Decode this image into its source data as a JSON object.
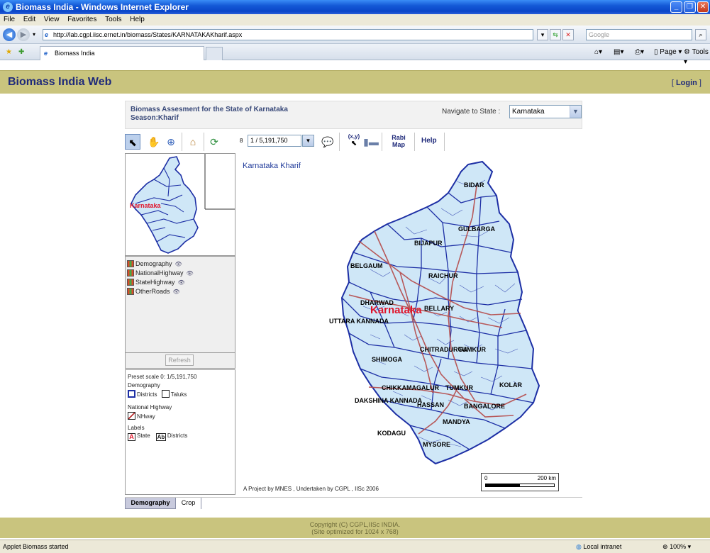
{
  "window": {
    "title": "Biomass India - Windows Internet Explorer"
  },
  "menu": [
    "File",
    "Edit",
    "View",
    "Favorites",
    "Tools",
    "Help"
  ],
  "address": {
    "url": "http://lab.cgpl.iisc.ernet.in/biomass/States/KARNATAKAKharif.aspx",
    "search_placeholder": "Google"
  },
  "tabs": {
    "active": "Biomass India",
    "page_label": "Page",
    "tools_label": "Tools"
  },
  "header": {
    "brand": "Biomass India Web",
    "login": "Login"
  },
  "state_panel": {
    "line1": "Biomass Assesment for the State of Karnataka",
    "line2": "Season:Kharif",
    "navigate_label": "Navigate to State :",
    "selected_state": "Karnataka"
  },
  "toolbar": {
    "scale_value": "1 / 5,191,750",
    "xy_label": "(x,y)",
    "rabi_line1": "Rabi",
    "rabi_line2": "Map",
    "help": "Help"
  },
  "overview": {
    "label": "Karnataka"
  },
  "layers": [
    "Demography",
    "NationalHighway",
    "StateHighway",
    "OtherRoads"
  ],
  "refresh": "Refresh",
  "legend": {
    "preset": "Preset scale 0: 1/5,191,750",
    "demography": "Demography",
    "districts": "Districts",
    "taluks": "Taluks",
    "national_highway": "National Highway",
    "nhway": "NHway",
    "labels": "Labels",
    "state": "State",
    "districts_label": "Districts",
    "state_glyph": "A",
    "districts_glyph": "Ab"
  },
  "bottom_tabs": {
    "demography": "Demography",
    "crop": "Crop"
  },
  "map": {
    "caption": "Karnataka Kharif",
    "state_label": "Karnataka",
    "districts": [
      "BIDAR",
      "GULBARGA",
      "BIJAPUR",
      "BELGAUM",
      "RAICHUR",
      "DHARWAD",
      "BELLARY",
      "UTTARA KANNADA",
      "CHITRADURGA",
      "TUMKUR",
      "SHIMOGA",
      "CHIKKAMAGALUR",
      "TUMKUR",
      "KOLAR",
      "DAKSHINA KANNADA",
      "HASSAN",
      "BANGALORE",
      "MANDYA",
      "KODAGU",
      "MYSORE"
    ],
    "credit": "A Project by MNES , Undertaken by CGPL , IISc 2006",
    "scale_start": "0",
    "scale_end": "200 km"
  },
  "footer": {
    "line1": "Copyright (C) CGPL,IISc INDIA.",
    "line2": "(Site optimized for 1024 x 768)"
  },
  "status": {
    "message": "Applet Biomass started",
    "zone": "Local intranet",
    "zoom": "100%"
  }
}
